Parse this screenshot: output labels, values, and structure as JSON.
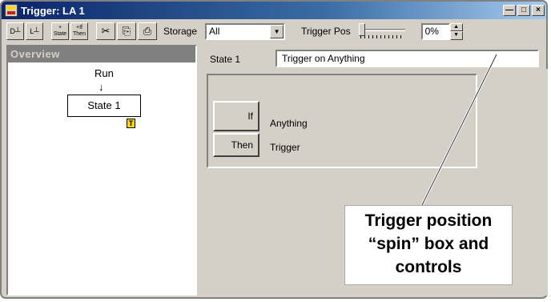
{
  "window": {
    "title": "Trigger: LA 1"
  },
  "toolbar": {
    "buttons": [
      {
        "name": "d-trigger-button",
        "label": "D┴"
      },
      {
        "name": "l-trigger-button",
        "label": "L┴"
      },
      {
        "name": "add-state-button",
        "label": "+ State"
      },
      {
        "name": "add-if-then-button",
        "label": "+If Then"
      },
      {
        "name": "cut-button",
        "label": "✂"
      },
      {
        "name": "copy-button",
        "label": "⎘"
      },
      {
        "name": "paste-button",
        "label": "⎙"
      }
    ],
    "storage_label": "Storage",
    "storage_value": "All",
    "trigger_pos_label": "Trigger Pos",
    "trigger_pos_value": "0%",
    "trigger_pos_fraction": 0
  },
  "overview": {
    "title": "Overview",
    "run_label": "Run",
    "state_label": "State 1",
    "trigger_badge": "T"
  },
  "state_editor": {
    "state_name": "State 1",
    "state_description": "Trigger on Anything",
    "if_label": "If",
    "if_condition": "Anything",
    "then_label": "Then",
    "then_action": "Trigger"
  },
  "callout": {
    "lines": [
      "Trigger position",
      "“spin” box and",
      "controls"
    ]
  },
  "colors": {
    "titlebar_start": "#0a246a",
    "titlebar_end": "#a6caf0",
    "face": "#d4d0c8",
    "overview_header": "#808080",
    "trigger_badge": "#ffd800"
  }
}
